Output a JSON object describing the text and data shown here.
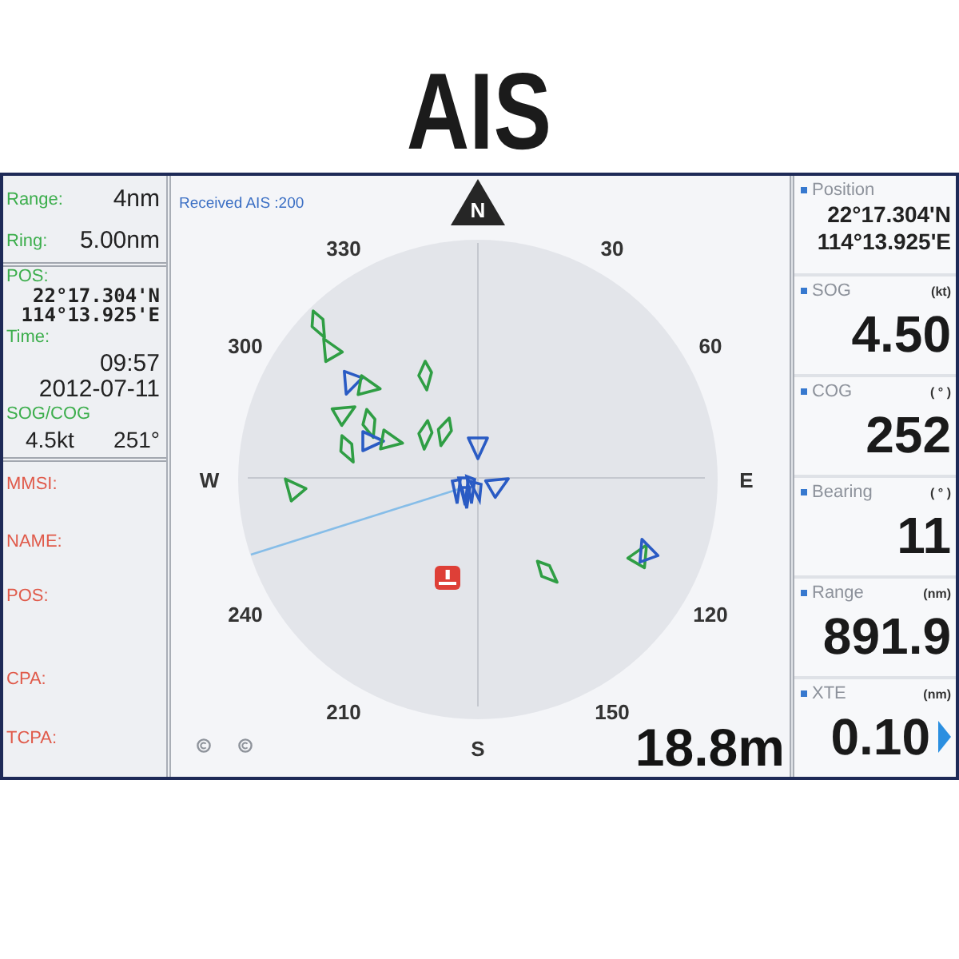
{
  "title": "AIS",
  "left_panel": {
    "settings": [
      {
        "label": "Range:",
        "value": "4nm"
      },
      {
        "label": "Ring:",
        "value": "5.00nm"
      }
    ],
    "own_ship": {
      "pos_label": "POS:",
      "latitude": "22°17.304'N",
      "longitude": "114°13.925'E",
      "time_label": "Time:",
      "time": "09:57",
      "date": "2012-07-11",
      "sog_cog_label": "SOG/COG",
      "sog": "4.5kt",
      "cog": "251°"
    },
    "target_fields": [
      "MMSI:",
      "NAME:",
      "POS:",
      "CPA:",
      "TCPA:"
    ]
  },
  "radar": {
    "received": "Received AIS :200",
    "north": "N",
    "bearing_labels": [
      "30",
      "60",
      "E",
      "120",
      "150",
      "S",
      "210",
      "240",
      "W",
      "300",
      "330"
    ],
    "targets": [
      {
        "kind": "vessel",
        "color": "#2f9e44"
      },
      {
        "kind": "vessel",
        "color": "#2f9e44"
      },
      {
        "kind": "vessel",
        "color": "#2f9e44"
      },
      {
        "kind": "vessel",
        "color": "#2a5bc4"
      },
      {
        "kind": "vessel",
        "color": "#2f9e44"
      },
      {
        "kind": "vessel",
        "color": "#2f9e44"
      },
      {
        "kind": "vessel",
        "color": "#2f9e44"
      },
      {
        "kind": "vessel",
        "color": "#2a5bc4"
      },
      {
        "kind": "vessel",
        "color": "#2f9e44"
      },
      {
        "kind": "vessel",
        "color": "#2f9e44"
      },
      {
        "kind": "vessel",
        "color": "#2f9e44"
      },
      {
        "kind": "vessel",
        "color": "#2f9e44"
      },
      {
        "kind": "vessel",
        "color": "#2a5bc4"
      },
      {
        "kind": "vessel",
        "color": "#2f9e44"
      },
      {
        "kind": "cluster",
        "color": "#2a5bc4"
      },
      {
        "kind": "vessel",
        "color": "#2a5bc4"
      },
      {
        "kind": "vessel",
        "color": "#2f9e44"
      },
      {
        "kind": "vessel",
        "color": "#2f9e44"
      },
      {
        "kind": "vessel",
        "color": "#2a5bc4"
      }
    ],
    "depth": "18.8m"
  },
  "data_boxes": [
    {
      "label": "Position",
      "lines": [
        "22°17.304'N",
        "114°13.925'E"
      ]
    },
    {
      "label": "SOG",
      "unit": "(kt)",
      "value": "4.50"
    },
    {
      "label": "COG",
      "unit": "( ° )",
      "value": "252"
    },
    {
      "label": "Bearing",
      "unit": "( ° )",
      "value": "11"
    },
    {
      "label": "Range",
      "unit": "(nm)",
      "value": "891.9"
    },
    {
      "label": "XTE",
      "unit": "(nm)",
      "value": "0.10",
      "pointer": true
    }
  ]
}
